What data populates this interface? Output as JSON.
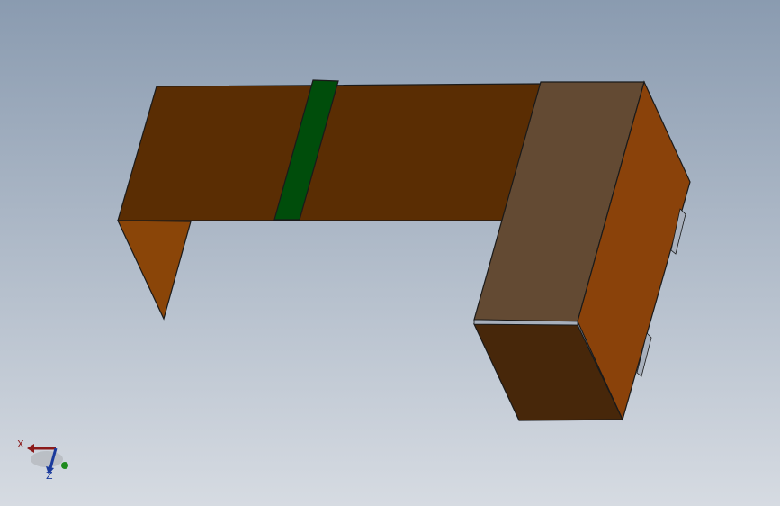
{
  "viewport": {
    "background_top": "#8a9bb0",
    "background_bottom": "#d6dbe2"
  },
  "model": {
    "colors": {
      "desk_top": "#5a2d03",
      "desk_side": "#8a4508",
      "strip": "#004d0b",
      "cabinet_top": "#634a33",
      "cabinet_side": "#8a420a",
      "cabinet_front": "#47270a",
      "edge": "#1a1a1a",
      "handle": "#a8b0bc"
    }
  },
  "triad": {
    "x_label": "X",
    "z_label": "Z",
    "x_color": "#8b1a1a",
    "y_color": "#1e8a1e",
    "z_color": "#1a3a9c"
  }
}
